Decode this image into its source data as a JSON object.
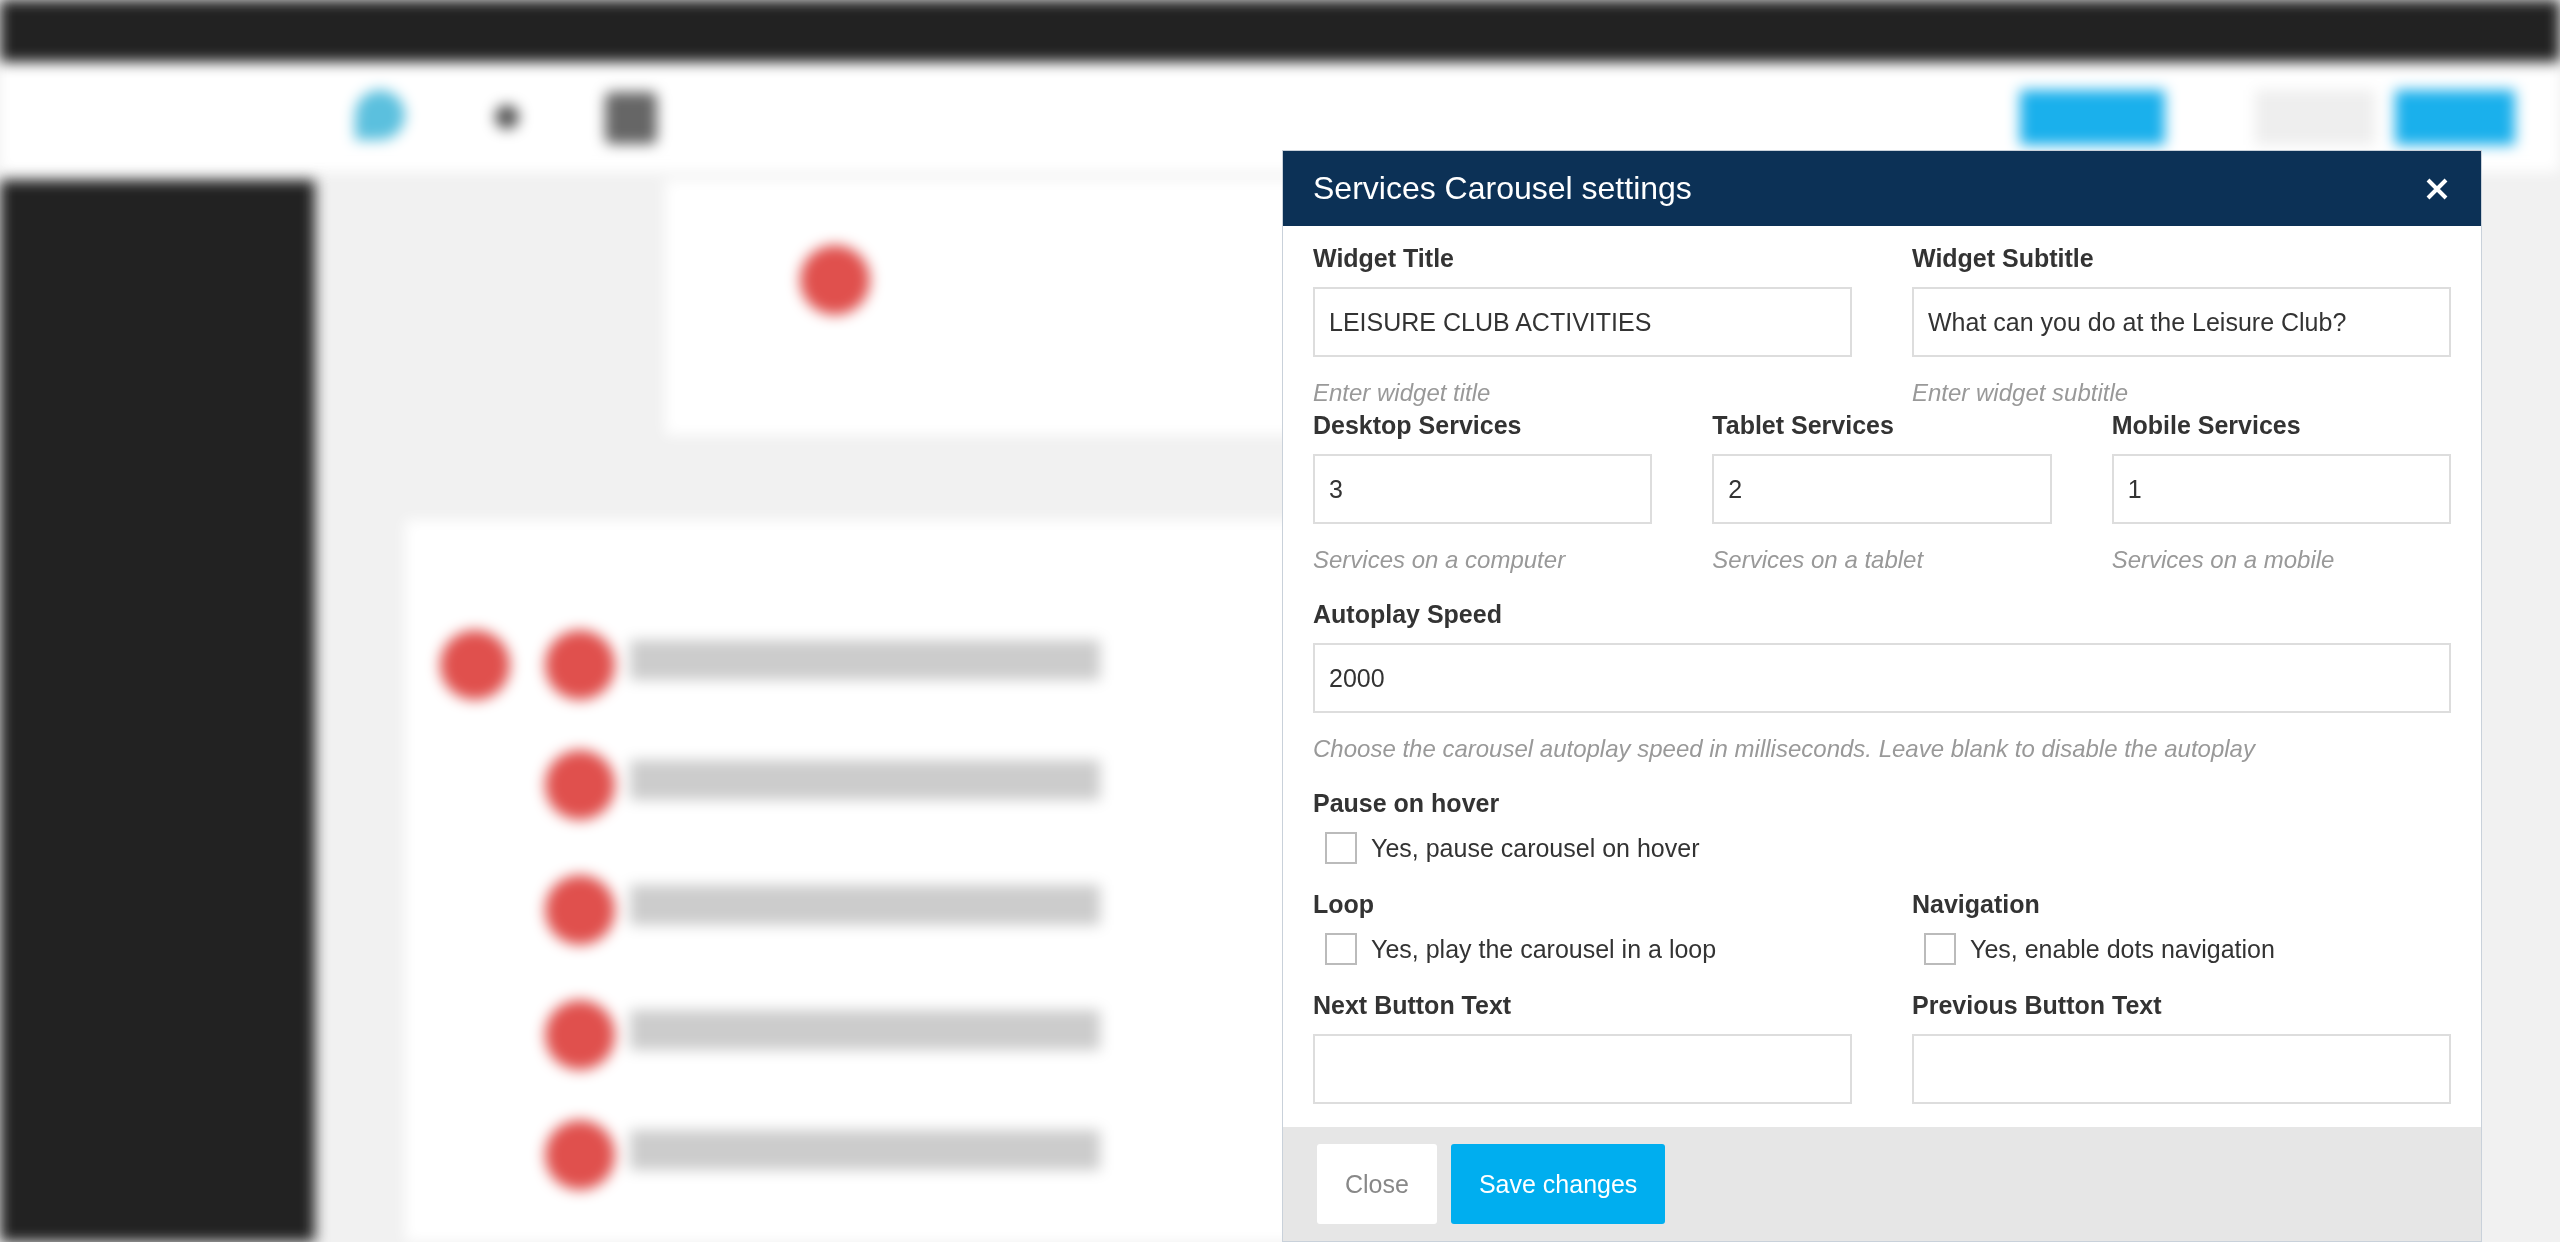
{
  "dialog": {
    "title": "Services Carousel settings",
    "rows": [
      {
        "kind": "fields",
        "items": [
          {
            "label": "Widget Title",
            "value": "LEISURE CLUB ACTIVITIES",
            "help": "Enter widget title"
          },
          {
            "label": "Widget Subtitle",
            "value": "What can you do at the Leisure Club?",
            "help": "Enter widget subtitle"
          }
        ]
      },
      {
        "kind": "fields",
        "items": [
          {
            "label": "Desktop Services",
            "value": "3",
            "help": "Services on a computer"
          },
          {
            "label": "Tablet Services",
            "value": "2",
            "help": "Services on a tablet"
          },
          {
            "label": "Mobile Services",
            "value": "1",
            "help": "Services on a mobile"
          }
        ]
      },
      {
        "kind": "fields",
        "items": [
          {
            "label": "Autoplay Speed",
            "value": "2000",
            "help": "Choose the carousel autoplay speed in milliseconds. Leave blank to disable the autoplay"
          }
        ]
      },
      {
        "kind": "checkboxes",
        "items": [
          {
            "label": "Pause on hover",
            "option": "Yes, pause carousel on hover",
            "checked": false
          },
          {
            "kind": "empty"
          }
        ]
      },
      {
        "kind": "checkboxes",
        "items": [
          {
            "label": "Loop",
            "option": "Yes, play the carousel in a loop",
            "checked": false
          },
          {
            "label": "Navigation",
            "option": "Yes, enable dots navigation",
            "checked": false
          }
        ]
      },
      {
        "kind": "fields",
        "items": [
          {
            "label": "Next Button Text"
          },
          {
            "label": "Previous Button Text"
          }
        ]
      }
    ],
    "buttons": [
      {
        "label": "Close",
        "kind": "secondary"
      },
      {
        "label": "Save changes",
        "kind": "primary"
      }
    ]
  }
}
